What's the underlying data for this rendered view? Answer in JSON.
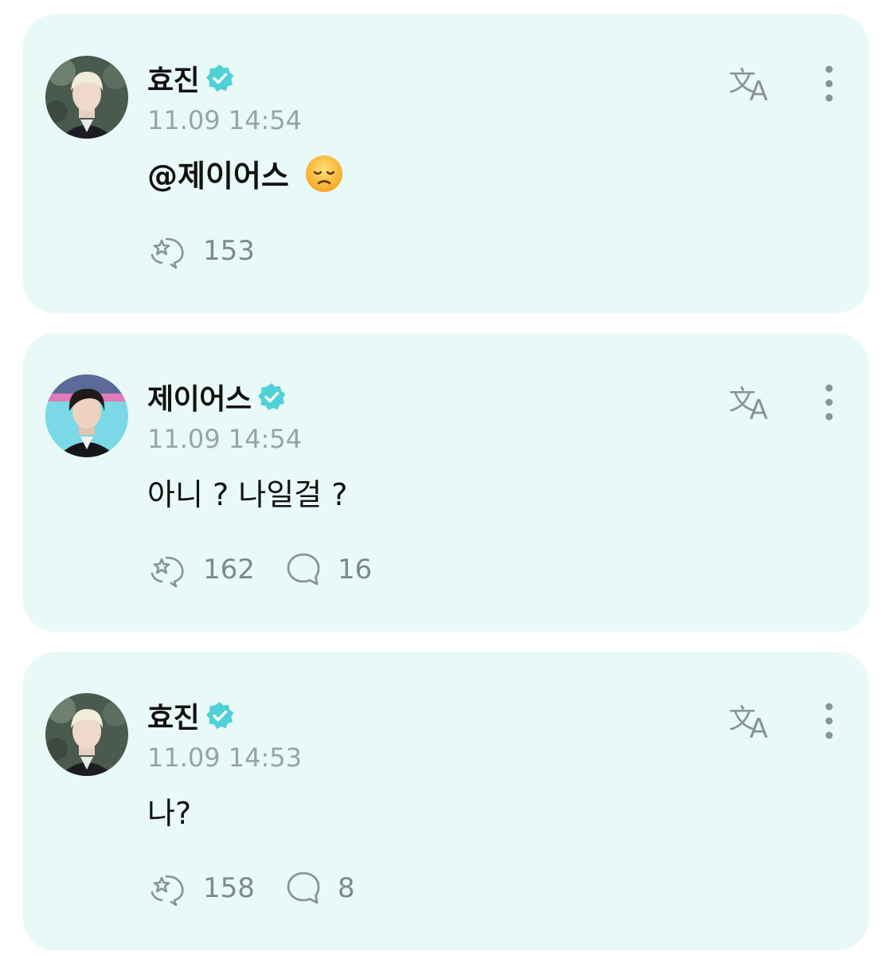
{
  "posts": [
    {
      "author": "효진",
      "verified_icon": "verified-badge-icon",
      "timestamp": "11.09 14:54",
      "text": "@제이어스",
      "emoji_icon": "disappointed-face-icon",
      "likes": "153",
      "comments": null
    },
    {
      "author": "제이어스",
      "verified_icon": "verified-badge-icon",
      "timestamp": "11.09 14:54",
      "text": "아니 ? 나일걸 ?",
      "likes": "162",
      "comments": "16"
    },
    {
      "author": "효진",
      "verified_icon": "verified-badge-icon",
      "timestamp": "11.09 14:53",
      "text": "나?",
      "likes": "158",
      "comments": "8"
    }
  ],
  "icons": {
    "translate": "translate-icon",
    "more": "more-vertical-icon",
    "like": "like-cheer-icon",
    "comment": "comment-bubble-icon"
  },
  "colors": {
    "card_background": "#e9f9f7",
    "verified": "#4fd1d6",
    "icon_gray": "#8a9494",
    "text_secondary": "#9aa3a3"
  }
}
